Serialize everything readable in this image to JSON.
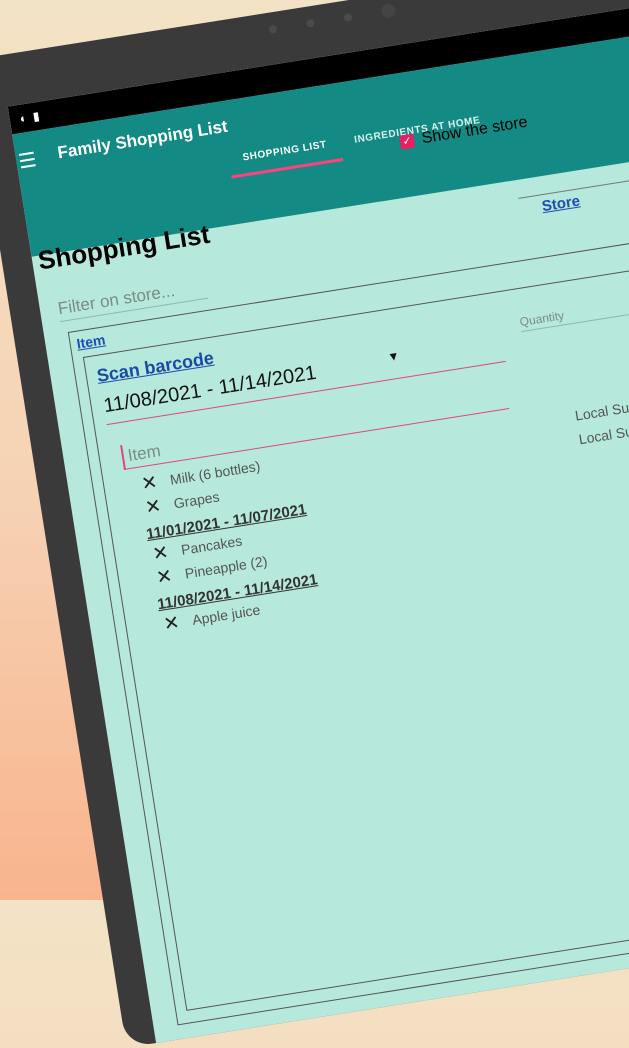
{
  "app": {
    "title": "Family Shopping List"
  },
  "tabs": [
    {
      "label": "SHOPPING LIST",
      "active": true
    },
    {
      "label": "INGREDIENTS AT HOME",
      "active": false
    }
  ],
  "toolbar": {
    "show_store_label": "Show the store",
    "show_store_checked": true
  },
  "page": {
    "title": "Shopping List",
    "store_header": "Store",
    "item_header": "Item"
  },
  "filter": {
    "placeholder": "Filter on store..."
  },
  "entry": {
    "scan_label": "Scan barcode",
    "selected_range": "11/08/2021 - 11/14/2021",
    "quantity_placeholder": "Quantity",
    "item_placeholder": "Item"
  },
  "groups": [
    {
      "header": "",
      "items": [
        {
          "name": "Milk (6 bottles)",
          "store": "Local Super"
        },
        {
          "name": "Grapes",
          "store": "Local Supe"
        }
      ]
    },
    {
      "header": "11/01/2021 - 11/07/2021",
      "items": [
        {
          "name": "Pancakes",
          "store": ""
        },
        {
          "name": "Pineapple (2)",
          "store": ""
        }
      ]
    },
    {
      "header": "11/08/2021 - 11/14/2021",
      "items": [
        {
          "name": "Apple juice",
          "store": ""
        }
      ]
    }
  ],
  "colors": {
    "app_bar": "#148a84",
    "screen_bg": "#b6e8db",
    "accent_pink": "#e91e63",
    "link_blue": "#1f4db6"
  },
  "icons": {
    "delete": "close-icon",
    "menu": "menu-icon",
    "checkbox": "check-icon"
  }
}
